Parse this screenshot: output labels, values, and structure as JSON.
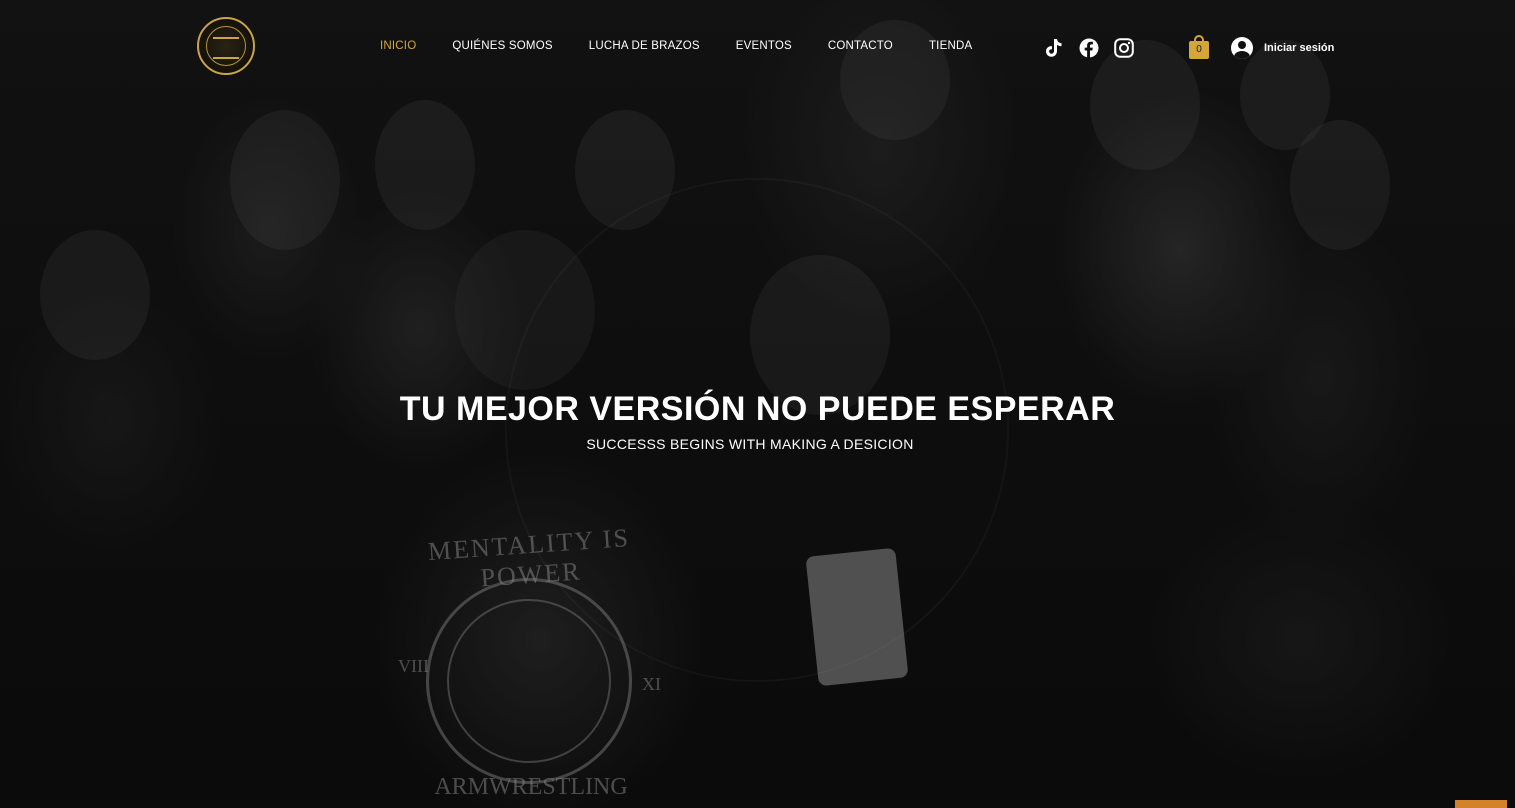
{
  "header": {
    "logo_name": "logo",
    "nav": [
      {
        "label": "INICIO",
        "active": true
      },
      {
        "label": "QUIÉNES SOMOS",
        "active": false
      },
      {
        "label": "LUCHA DE BRAZOS",
        "active": false
      },
      {
        "label": "EVENTOS",
        "active": false
      },
      {
        "label": "CONTACTO",
        "active": false
      },
      {
        "label": "TIENDA",
        "active": false
      }
    ],
    "social_icons": [
      "tiktok-icon",
      "facebook-icon",
      "instagram-icon"
    ],
    "cart_count": "0",
    "login_label": "Iniciar sesión"
  },
  "hero": {
    "title": "TU MEJOR VERSIÓN NO PUEDE ESPERAR",
    "subtitle": "SUCCESSS BEGINS WITH MAKING A DESICION"
  },
  "background": {
    "shirt_top_text": "MENTALITY IS POWER",
    "shirt_left_numeral": "VIII",
    "shirt_right_numeral": "XI",
    "shirt_bottom_text": "ARMWRESTLING"
  },
  "colors": {
    "accent": "#d4a63a",
    "text": "#ffffff",
    "background": "#111111"
  }
}
